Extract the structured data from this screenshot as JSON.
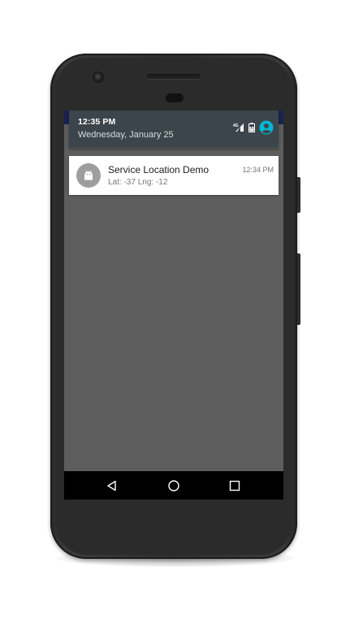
{
  "status_header": {
    "time": "12:35 PM",
    "date": "Wednesday, January 25",
    "icons": [
      "signal-4g-icon",
      "battery-icon",
      "account-icon"
    ],
    "network_label": "4G",
    "account_color": "#00b8d4"
  },
  "notification": {
    "app_icon": "android-icon",
    "title": "Service Location Demo",
    "text": "Lat: -37  Lng: -12",
    "time": "12:34 PM"
  },
  "navigation": {
    "buttons": [
      "back-icon",
      "home-icon",
      "recents-icon"
    ]
  },
  "colors": {
    "status_strip": "#1b2151",
    "shade_header": "#3d454c",
    "screen_background": "#5d5d5d",
    "notification_background": "#ffffff",
    "phone_body": "#2e2e2e"
  }
}
